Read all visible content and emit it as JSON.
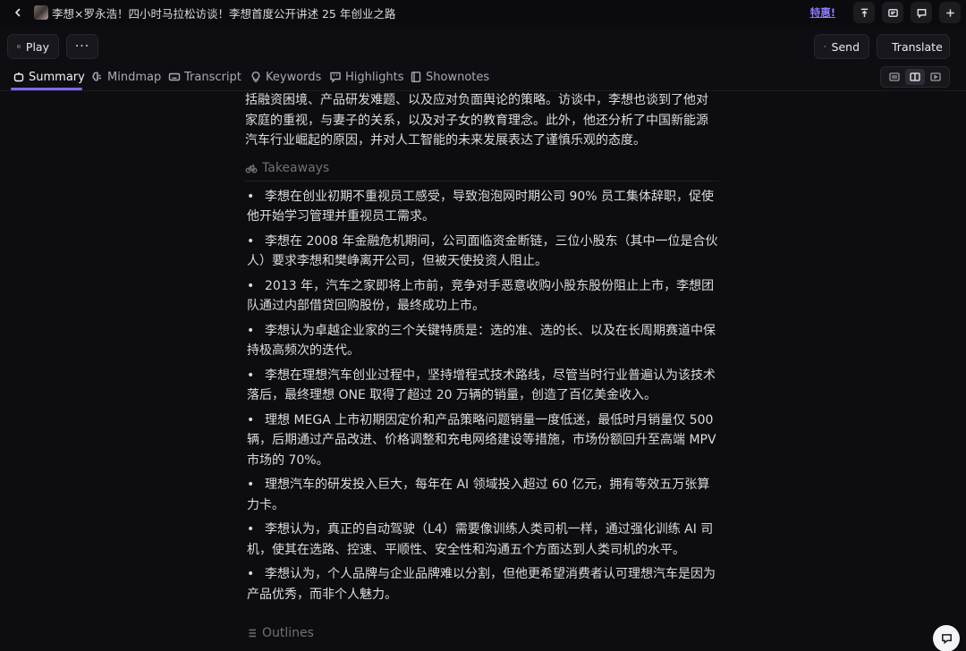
{
  "titlebar": {
    "back_label": "‹",
    "title": "李想×罗永浩！四小时马拉松访谈！李想首度公开讲述 25 年创业之路",
    "promo": "特惠!",
    "icons": [
      "pin-top-icon",
      "window-icon",
      "message-icon",
      "add-icon"
    ]
  },
  "toolbar": {
    "play_label": "Play",
    "more_label": "···",
    "send_label": "Send",
    "translate_label": "Translate"
  },
  "tabs": [
    {
      "label": "Summary",
      "active": true
    },
    {
      "label": "Mindmap",
      "active": false
    },
    {
      "label": "Transcript",
      "active": false
    },
    {
      "label": "Keywords",
      "active": false
    },
    {
      "label": "Highlights",
      "active": false
    },
    {
      "label": "Shownotes",
      "active": false
    }
  ],
  "view_toggle": {
    "selected": "split"
  },
  "content": {
    "summary_tail": "括融资困境、产品研发难题、以及应对负面舆论的策略。访谈中，李想也谈到了他对家庭的重视，与妻子的关系，以及对子女的教育理念。此外，他还分析了中国新能源汽车行业崛起的原因，并对人工智能的未来发展表达了谨慎乐观的态度。",
    "takeaways_heading": "Takeaways",
    "takeaways": [
      "李想在创业初期不重视员工感受，导致泡泡网时期公司 90% 员工集体辞职，促使他开始学习管理并重视员工需求。",
      "李想在 2008 年金融危机期间，公司面临资金断链，三位小股东（其中一位是合伙人）要求李想和樊峥离开公司，但被天使投资人阻止。",
      "2013 年，汽车之家即将上市前，竞争对手恶意收购小股东股份阻止上市，李想团队通过内部借贷回购股份，最终成功上市。",
      "李想认为卓越企业家的三个关键特质是：选的准、选的长、以及在长周期赛道中保持极高频次的迭代。",
      "李想在理想汽车创业过程中，坚持增程式技术路线，尽管当时行业普遍认为该技术落后，最终理想 ONE 取得了超过 20 万辆的销量，创造了百亿美金收入。",
      "理想 MEGA 上市初期因定价和产品策略问题销量一度低迷，最低时月销量仅 500 辆，后期通过产品改进、价格调整和充电网络建设等措施，市场份额回升至高端 MPV 市场的 70%。",
      "理想汽车的研发投入巨大，每年在 AI 领域投入超过 60 亿元，拥有等效五万张算力卡。",
      "李想认为，真正的自动驾驶（L4）需要像训练人类司机一样，通过强化训练 AI 司机，使其在选路、控速、平顺性、安全性和沟通五个方面达到人类司机的水平。",
      "李想认为，个人品牌与企业品牌难以分割，但他更希望消费者认可理想汽车是因为产品优秀，而非个人魅力。"
    ],
    "outlines_heading": "Outlines"
  },
  "colors": {
    "background": "#0d0d10",
    "accent": "#7c6cf5",
    "promo": "#8b7cf6",
    "text": "#dcdce1",
    "muted": "#6f6f78"
  }
}
